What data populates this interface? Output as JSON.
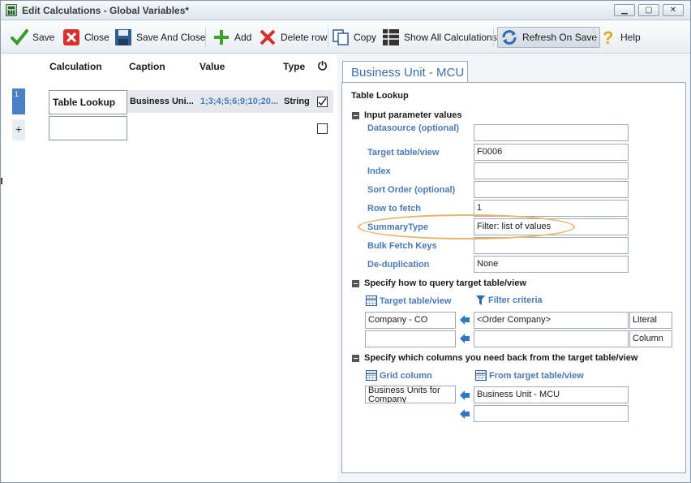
{
  "window": {
    "title": "Edit Calculations - Global Variables*",
    "minimize": "▁",
    "maximize": "▢",
    "close": "✕"
  },
  "toolbar": {
    "save": "Save",
    "close": "Close",
    "save_and_close": "Save And Close",
    "add": "Add",
    "delete_row": "Delete row",
    "copy": "Copy",
    "show_all": "Show All Calculations",
    "refresh_on_save": "Refresh On Save",
    "help": "Help"
  },
  "grid": {
    "headers": {
      "calculation": "Calculation",
      "caption": "Caption",
      "value": "Value",
      "type": "Type",
      "active_icon": "⏻"
    },
    "rows": [
      {
        "index": "1",
        "calculation": "Table Lookup",
        "caption": "Business Uni...",
        "value": "1;3;4;5;6;9;10;20...",
        "type": "String",
        "checked": true
      }
    ],
    "new_row_marker": "+"
  },
  "panel": {
    "tab_title": "Business Unit - MCU",
    "calc_type": "Table Lookup",
    "input_section": "Input parameter values",
    "params": [
      {
        "label": "Datasource (optional)",
        "value": ""
      },
      {
        "label": "Target table/view",
        "value": "F0006"
      },
      {
        "label": "Index",
        "value": ""
      },
      {
        "label": "Sort Order (optional)",
        "value": ""
      },
      {
        "label": "Row to fetch",
        "value": "1"
      },
      {
        "label": "SummaryType",
        "value": "Filter: list of values"
      },
      {
        "label": "Bulk Fetch Keys",
        "value": ""
      },
      {
        "label": "De-duplication",
        "value": "None"
      }
    ],
    "query_section": "Specify how to query target table/view",
    "query_headers": {
      "target": "Target table/view",
      "filter": "Filter criteria"
    },
    "query_rows": [
      {
        "target": "Company - CO",
        "filter": "<Order Company>",
        "kind": "Literal"
      },
      {
        "target": "",
        "filter": "",
        "kind": "Column"
      }
    ],
    "columns_section": "Specify which columns you need back from the target table/view",
    "columns_headers": {
      "grid": "Grid column",
      "from": "From target table/view"
    },
    "columns_rows": [
      {
        "grid": "Business Units for Company",
        "from": "Business Unit - MCU"
      },
      {
        "grid": "",
        "from": ""
      }
    ]
  }
}
